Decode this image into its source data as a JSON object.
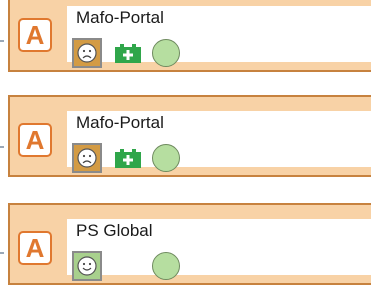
{
  "cards": [
    {
      "logo": "A",
      "title": "Mafo-Portal",
      "face_icon": "sad-face-icon",
      "has_battery": true,
      "dot_icon": "green-circle-icon"
    },
    {
      "logo": "A",
      "title": "Mafo-Portal",
      "face_icon": "sad-face-icon",
      "has_battery": true,
      "dot_icon": "green-circle-icon"
    },
    {
      "logo": "A",
      "title": "PS Global",
      "face_icon": "happy-face-icon",
      "has_battery": false,
      "dot_icon": "green-circle-icon"
    }
  ],
  "colors": {
    "card_bg": "#f8d2a6",
    "card_border": "#c7823f",
    "logo": "#e0782f",
    "sad_face_bg": "#d39b44",
    "happy_face_bg": "#a8d08d",
    "battery": "#2fa64a",
    "status_dot": "#b6dea0"
  }
}
